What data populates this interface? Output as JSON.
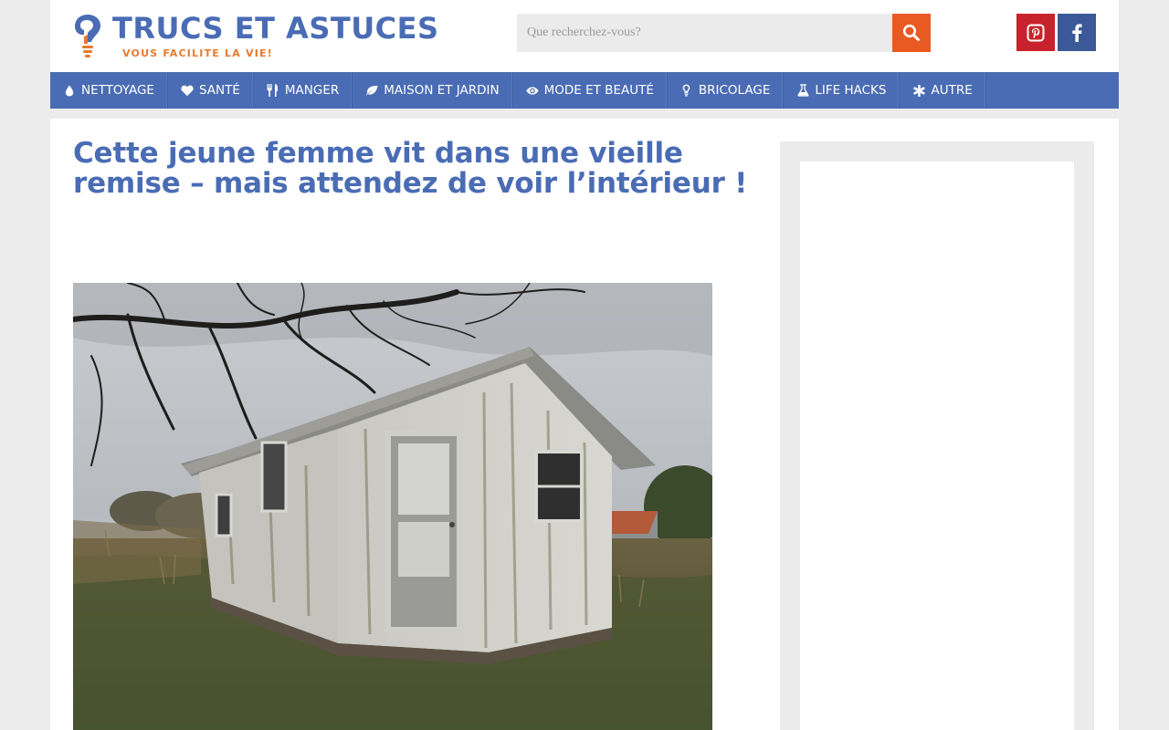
{
  "header": {
    "logo_title": "TRUCS ET ASTUCES",
    "logo_tagline": "VOUS FACILITE LA VIE!",
    "search_placeholder": "Que recherchez-vous?"
  },
  "nav": {
    "items": [
      {
        "label": "NETTOYAGE",
        "icon": "drop-icon"
      },
      {
        "label": "SANTÉ",
        "icon": "heart-icon"
      },
      {
        "label": "MANGER",
        "icon": "utensils-icon"
      },
      {
        "label": "MAISON ET JARDIN",
        "icon": "leaf-icon"
      },
      {
        "label": "MODE ET BEAUTÉ",
        "icon": "eye-icon"
      },
      {
        "label": "BRICOLAGE",
        "icon": "lightbulb-icon"
      },
      {
        "label": "LIFE HACKS",
        "icon": "flask-icon"
      },
      {
        "label": "AUTRE",
        "icon": "asterisk-icon"
      }
    ]
  },
  "article": {
    "title": "Cette jeune femme vit dans une vieille remise – mais attendez de voir l’intérieur !"
  },
  "colors": {
    "brand_blue": "#4a6cb4",
    "brand_orange": "#e8792e",
    "search_orange": "#e95a22",
    "pinterest_red": "#c8232c",
    "facebook_blue": "#3b5998"
  }
}
